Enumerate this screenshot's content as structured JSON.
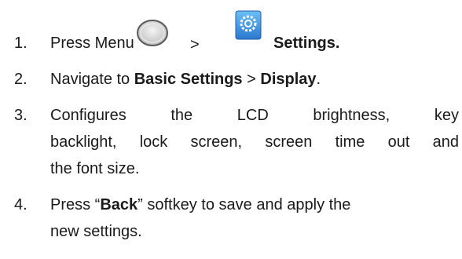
{
  "steps": [
    {
      "number": "1.",
      "press": "Press Menu",
      "sep": ">",
      "target": "Settings.",
      "icons": {
        "menu": "menu-key-icon",
        "settings": "settings-gear-icon"
      }
    },
    {
      "number": "2.",
      "pre": "Navigate to",
      "bold1": "Basic Settings",
      "sep": ">",
      "bold2": "Display",
      "end": "."
    },
    {
      "number": "3.",
      "words": [
        "Configures",
        "the",
        "LCD",
        "brightness,",
        "key"
      ],
      "line2": [
        "backlight,",
        "lock",
        "screen,",
        "screen",
        "time",
        "out",
        "and"
      ],
      "line3": "the font size."
    },
    {
      "number": "4.",
      "words_pre": "Press “",
      "bold": "Back",
      "words_post": "” softkey to save and apply the",
      "line2": "new settings."
    }
  ],
  "colors": {
    "text": "#1a1a1a",
    "gear": "#2f7fd6"
  }
}
